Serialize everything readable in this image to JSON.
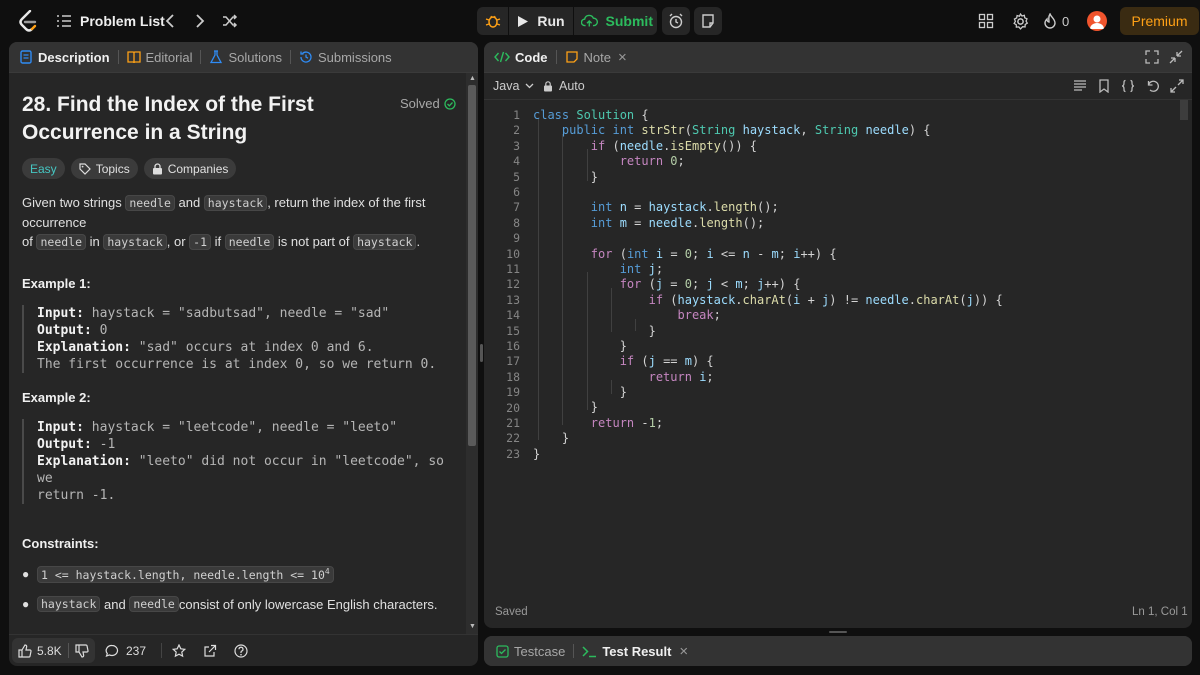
{
  "topbar": {
    "problem_list": "Problem List",
    "run": "Run",
    "submit": "Submit",
    "streak": "0",
    "premium": "Premium"
  },
  "left": {
    "tabs": [
      "Description",
      "Editorial",
      "Solutions",
      "Submissions"
    ],
    "title_line1": "28. Find the Index of the First",
    "title_line2": "Occurrence in a String",
    "solved": "Solved",
    "difficulty": "Easy",
    "topics": "Topics",
    "companies": "Companies",
    "desc": {
      "p1": "Given two strings ",
      "needle": "needle",
      "p2": " and ",
      "haystack": "haystack",
      "p3": ", return the index of the first occurrence",
      "p4": "of ",
      "p5": " in ",
      "p6": ", or ",
      "minus1": "-1",
      "p7": " if ",
      "p8": " is not part of ",
      "p9": "."
    },
    "example1": {
      "heading": "Example 1:",
      "input_label": "Input:",
      "input": " haystack = \"sadbutsad\", needle = \"sad\"",
      "output_label": "Output:",
      "output": " 0",
      "expl_label": "Explanation:",
      "expl1": " \"sad\" occurs at index 0 and 6.",
      "expl2": "The first occurrence is at index 0, so we return 0."
    },
    "example2": {
      "heading": "Example 2:",
      "input_label": "Input:",
      "input": " haystack = \"leetcode\", needle = \"leeto\"",
      "output_label": "Output:",
      "output": " -1",
      "expl_label": "Explanation:",
      "expl1": " \"leeto\" did not occur in \"leetcode\", so we",
      "expl2": "return -1."
    },
    "constraints": {
      "heading": "Constraints:",
      "c1": "1 <= haystack.length, needle.length <= 10",
      "c1_sup": "4",
      "c2_a": "haystack",
      "c2_b": " and ",
      "c2_c": "needle",
      "c2_d": " consist of only lowercase English characters."
    },
    "footer": {
      "likes": "5.8K",
      "comments": "237"
    }
  },
  "editor": {
    "tab_code": "Code",
    "tab_note": "Note",
    "language": "Java",
    "auto": "Auto",
    "status": "Saved",
    "cursor": "Ln 1, Col 1",
    "line_count": 23
  },
  "bottom": {
    "testcase": "Testcase",
    "test_result": "Test Result"
  },
  "colors": {
    "accent": "#ffa116",
    "submit_green": "#2cbb5d",
    "easy": "#46c6c2",
    "solved": "#2cbb5d"
  }
}
